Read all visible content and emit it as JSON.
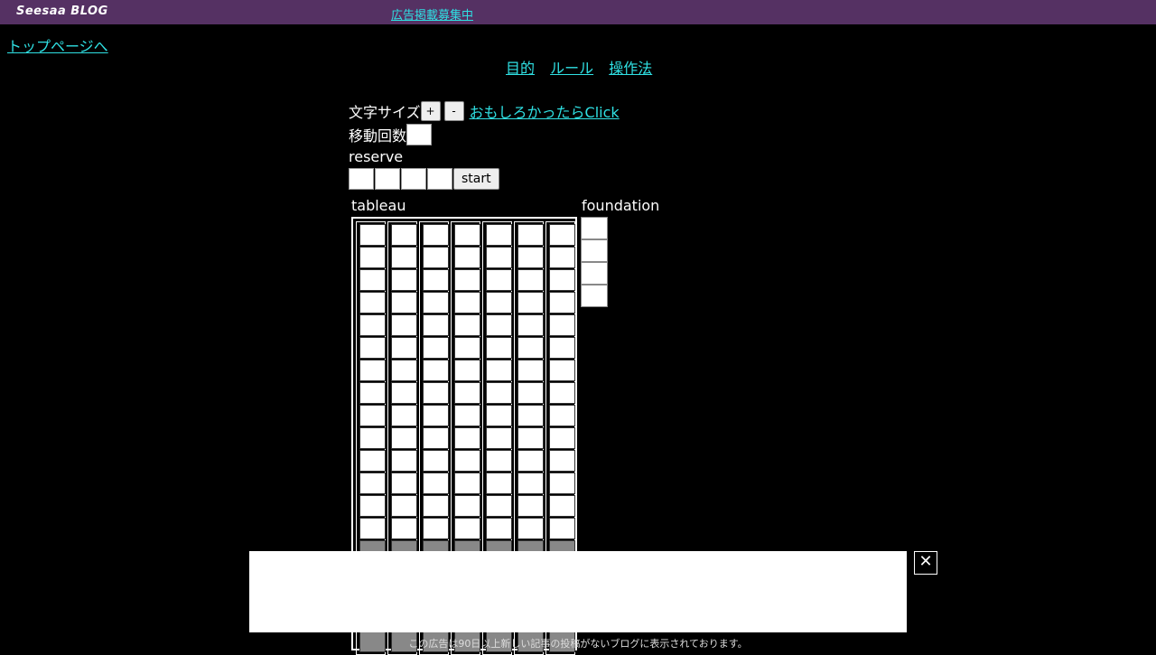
{
  "header": {
    "brand": "Seesaa BLOG",
    "ad_link": "広告掲載募集中"
  },
  "top_page_link": "トップページへ",
  "nav": {
    "purpose": "目的",
    "rules": "ルール",
    "controls": "操作法"
  },
  "controls": {
    "font_size_label": "文字サイズ",
    "plus_label": "+",
    "minus_label": "-",
    "fun_link": "おもしろかったらClick",
    "moves_label": "移動回数",
    "moves_value": "",
    "reserve_label": "reserve",
    "start_label": "start"
  },
  "tableau": {
    "label": "tableau",
    "columns": 7
  },
  "foundation": {
    "label": "foundation",
    "slots": 4
  },
  "ad": {
    "close_icon": "close-icon",
    "notice": "この広告は90日以上新しい記事の投稿がないブログに表示されております。"
  },
  "colors": {
    "topbar": "#553163",
    "link": "#2fe0e3",
    "background": "#000000"
  }
}
